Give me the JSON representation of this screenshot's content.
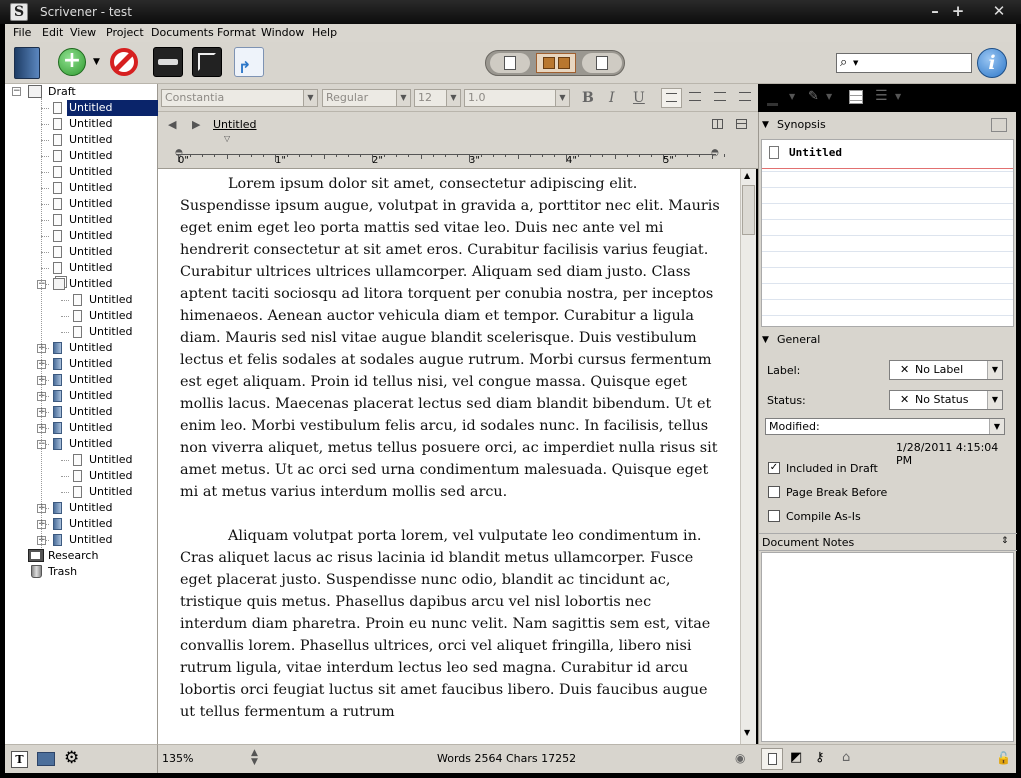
{
  "window": {
    "title": "Scrivener - test",
    "app_icon_letter": "S"
  },
  "menu": [
    "File",
    "Edit",
    "View",
    "Project",
    "Documents",
    "Format",
    "Window",
    "Help"
  ],
  "toolbar": {
    "search_placeholder": ""
  },
  "binder": {
    "draft_label": "Draft",
    "research_label": "Research",
    "trash_label": "Trash",
    "items": [
      {
        "label": "Untitled",
        "level": 1,
        "kind": "doc",
        "selected": true
      },
      {
        "label": "Untitled",
        "level": 1,
        "kind": "doc"
      },
      {
        "label": "Untitled",
        "level": 1,
        "kind": "doc"
      },
      {
        "label": "Untitled",
        "level": 1,
        "kind": "doc"
      },
      {
        "label": "Untitled",
        "level": 1,
        "kind": "doc"
      },
      {
        "label": "Untitled",
        "level": 1,
        "kind": "doc"
      },
      {
        "label": "Untitled",
        "level": 1,
        "kind": "doc"
      },
      {
        "label": "Untitled",
        "level": 1,
        "kind": "doc"
      },
      {
        "label": "Untitled",
        "level": 1,
        "kind": "doc"
      },
      {
        "label": "Untitled",
        "level": 1,
        "kind": "doc"
      },
      {
        "label": "Untitled",
        "level": 1,
        "kind": "doc"
      },
      {
        "label": "Untitled",
        "level": 1,
        "kind": "stack",
        "toggle": "−"
      },
      {
        "label": "Untitled",
        "level": 2,
        "kind": "doc"
      },
      {
        "label": "Untitled",
        "level": 2,
        "kind": "doc"
      },
      {
        "label": "Untitled",
        "level": 2,
        "kind": "doc"
      },
      {
        "label": "Untitled",
        "level": 1,
        "kind": "folder",
        "toggle": "+"
      },
      {
        "label": "Untitled",
        "level": 1,
        "kind": "folder",
        "toggle": "+"
      },
      {
        "label": "Untitled",
        "level": 1,
        "kind": "folder",
        "toggle": "+"
      },
      {
        "label": "Untitled",
        "level": 1,
        "kind": "folder",
        "toggle": "+"
      },
      {
        "label": "Untitled",
        "level": 1,
        "kind": "folder",
        "toggle": "+"
      },
      {
        "label": "Untitled",
        "level": 1,
        "kind": "folder",
        "toggle": "+"
      },
      {
        "label": "Untitled",
        "level": 1,
        "kind": "folder",
        "toggle": "−"
      },
      {
        "label": "Untitled",
        "level": 2,
        "kind": "doc"
      },
      {
        "label": "Untitled",
        "level": 2,
        "kind": "doc"
      },
      {
        "label": "Untitled",
        "level": 2,
        "kind": "doc"
      },
      {
        "label": "Untitled",
        "level": 1,
        "kind": "folder",
        "toggle": "+"
      },
      {
        "label": "Untitled",
        "level": 1,
        "kind": "folder",
        "toggle": "+"
      },
      {
        "label": "Untitled",
        "level": 1,
        "kind": "folder",
        "toggle": "+"
      }
    ]
  },
  "format_bar": {
    "font": "Constantia",
    "style": "Regular",
    "size": "12",
    "spacing": "1.0",
    "bold": "B",
    "italic": "I",
    "underline": "U"
  },
  "editor_header": {
    "doc_title": "Untitled"
  },
  "ruler": {
    "marks": [
      "0\"",
      "1\"",
      "2\"",
      "3\"",
      "4\"",
      "5\""
    ]
  },
  "editor": {
    "paragraphs": [
      "Lorem ipsum dolor sit amet, consectetur adipiscing elit. Suspendisse ipsum augue, volutpat in gravida a, porttitor nec elit. Mauris eget enim eget leo porta mattis sed vitae leo. Duis nec ante vel mi hendrerit consectetur at sit amet eros. Curabitur facilisis varius feugiat. Curabitur ultrices ultrices ullamcorper. Aliquam sed diam justo. Class aptent taciti sociosqu ad litora torquent per conubia nostra, per inceptos himenaeos. Aenean auctor vehicula diam et tempor. Curabitur a ligula diam. Mauris sed nisl vitae augue blandit scelerisque. Duis vestibulum lectus et felis sodales at sodales augue rutrum. Morbi cursus fermentum est eget aliquam. Proin id tellus nisi, vel congue massa. Quisque eget mollis lacus. Maecenas placerat lectus sed diam blandit bibendum. Ut et enim leo. Morbi vestibulum felis arcu, id sodales nunc. In facilisis, tellus non viverra aliquet, metus tellus posuere orci, ac imperdiet nulla risus sit amet metus. Ut ac orci sed urna condimentum malesuada. Quisque eget mi at metus varius interdum mollis sed arcu.",
      "Aliquam volutpat porta lorem, vel vulputate leo condimentum in. Cras aliquet lacus ac risus lacinia id blandit metus ullamcorper. Fusce eget placerat justo. Suspendisse nunc odio, blandit ac tincidunt ac, tristique quis metus. Phasellus dapibus arcu vel nisl lobortis nec interdum diam pharetra. Proin eu nunc velit. Nam sagittis sem est, vitae convallis lorem. Phasellus ultrices, orci vel aliquet fringilla, libero nisi rutrum ligula, vitae interdum lectus leo sed magna. Curabitur id arcu lobortis orci feugiat luctus sit amet faucibus libero. Duis faucibus augue ut tellus fermentum a rutrum"
    ]
  },
  "status": {
    "zoom": "135%",
    "counts": "Words 2564 Chars 17252"
  },
  "inspector": {
    "synopsis_header": "Synopsis",
    "synopsis_title": "Untitled",
    "general_header": "General",
    "label_caption": "Label:",
    "label_value": "No Label",
    "status_caption": "Status:",
    "status_value": "No Status",
    "modified_caption": "Modified:",
    "modified_value": "1/28/2011 4:15:04 PM",
    "included_in_draft": "Included in Draft",
    "page_break_before": "Page Break Before",
    "compile_as_is": "Compile As-Is",
    "notes_header": "Document Notes"
  },
  "colors": {
    "selection": "#0a246a",
    "chrome": "#d8d5ce",
    "add_green": "#2f9a2f",
    "stop_red": "#d62020",
    "info_blue": "#2d77c8"
  }
}
